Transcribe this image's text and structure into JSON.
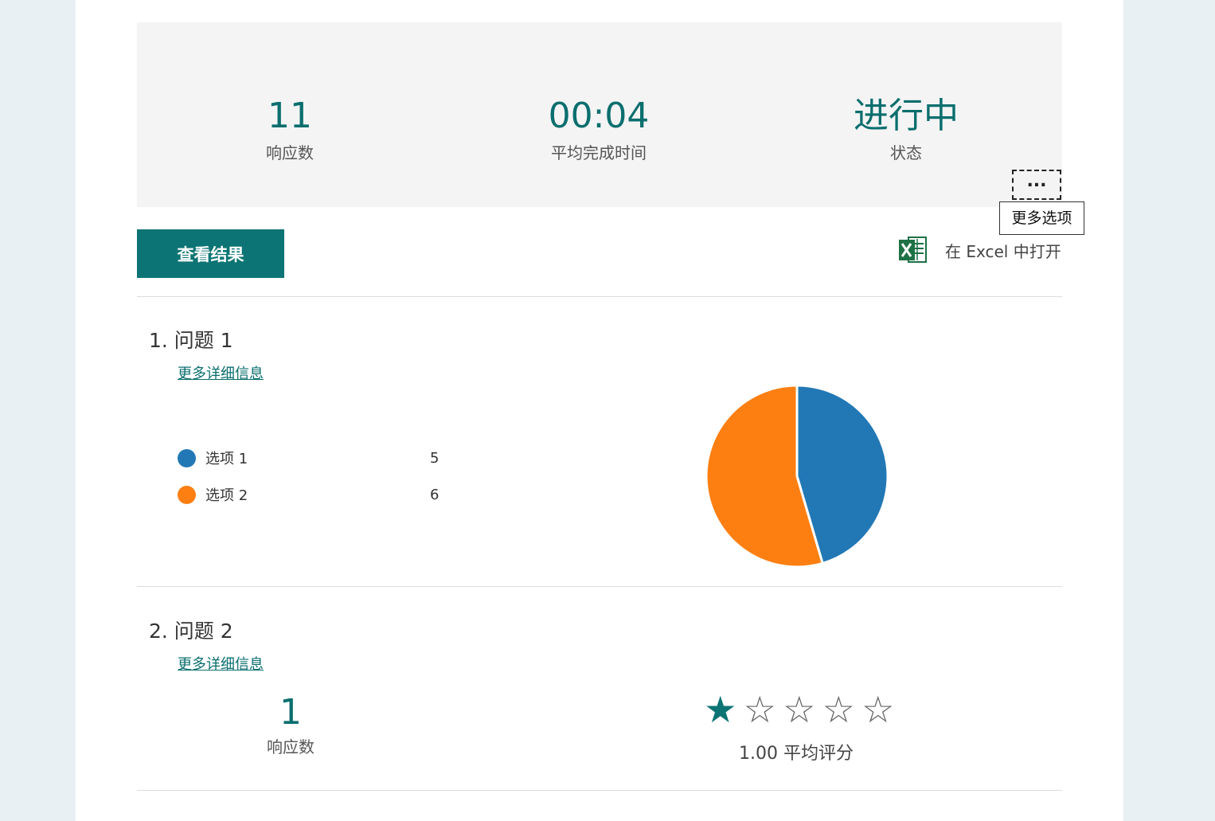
{
  "summary": {
    "responses": {
      "value": "11",
      "label": "响应数"
    },
    "avg_time": {
      "value": "00:04",
      "label": "平均完成时间"
    },
    "status": {
      "value": "进行中",
      "label": "状态"
    }
  },
  "more_options": {
    "glyph": "...",
    "tooltip": "更多选项"
  },
  "toolbar": {
    "view_results": "查看结果",
    "open_excel": "在 Excel 中打开"
  },
  "questions": [
    {
      "title": "1.  问题 1",
      "details_link": "更多详细信息",
      "options": [
        {
          "label": "选项 1",
          "count": 5,
          "color": "#2278b5"
        },
        {
          "label": "选项 2",
          "count": 6,
          "color": "#fd7f12"
        }
      ]
    },
    {
      "title": "2.  问题 2",
      "details_link": "更多详细信息",
      "responses": {
        "value": "1",
        "label": "响应数"
      },
      "rating": {
        "value": 1,
        "max": 5,
        "label": "1.00 平均评分"
      }
    }
  ],
  "chart_data": {
    "type": "pie",
    "categories": [
      "选项 1",
      "选项 2"
    ],
    "values": [
      5,
      6
    ],
    "colors": [
      "#2278b5",
      "#fd7f12"
    ]
  },
  "colors": {
    "accent": "#0c7474",
    "star_filled": "#0c7474",
    "star_empty": "#666666"
  }
}
